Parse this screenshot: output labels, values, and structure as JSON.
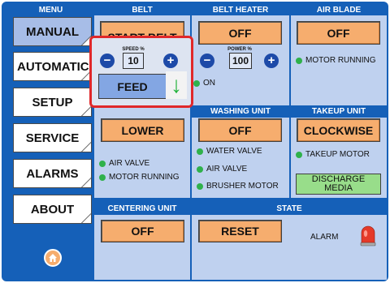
{
  "sidebar": {
    "header": "MENU",
    "items": [
      {
        "label": "MANUAL"
      },
      {
        "label": "AUTOMATIC"
      },
      {
        "label": "SETUP"
      },
      {
        "label": "SERVICE"
      },
      {
        "label": "ALARMS"
      },
      {
        "label": "ABOUT"
      }
    ]
  },
  "belt": {
    "header": "BELT",
    "start_label": "START BELT",
    "speed_label": "SPEED %",
    "speed_value": "10",
    "feed_label": "FEED",
    "indicator": "ON"
  },
  "belt_heater": {
    "header": "BELT HEATER",
    "button_label": "OFF",
    "power_label": "POWER %",
    "power_value": "100"
  },
  "air_blade": {
    "header": "AIR BLADE",
    "button_label": "OFF",
    "indicator": "MOTOR RUNNING"
  },
  "pressure_roller": {
    "button_label": "LOWER",
    "indicators": [
      "AIR VALVE",
      "MOTOR RUNNING"
    ]
  },
  "washing_unit": {
    "header": "WASHING UNIT",
    "button_label": "OFF",
    "indicators": [
      "WATER VALVE",
      "AIR VALVE",
      "BRUSHER MOTOR"
    ]
  },
  "takeup_unit": {
    "header": "TAKEUP UNIT",
    "button_label": "CLOCKWISE",
    "indicator": "TAKEUP MOTOR",
    "discharge_line1": "DISCHARGE",
    "discharge_line2": "MEDIA"
  },
  "centering_unit": {
    "header": "CENTERING UNIT",
    "button_label": "OFF"
  },
  "state": {
    "header": "STATE",
    "reset_label": "RESET",
    "alarm_label": "ALARM"
  },
  "colors": {
    "frame_blue": "#1560b8",
    "panel_bg": "#bfd1ef",
    "button_orange": "#f6ad6e",
    "button_green": "#98dd8a",
    "indicator_green": "#2fb14b",
    "highlight_red": "#e0282a",
    "alarm_red": "#e53a2a"
  },
  "icons": {
    "feed": "green-down-arrow-icon",
    "home": "home-icon",
    "alarm": "beacon-light-icon",
    "minus": "minus-icon",
    "plus": "plus-icon"
  }
}
